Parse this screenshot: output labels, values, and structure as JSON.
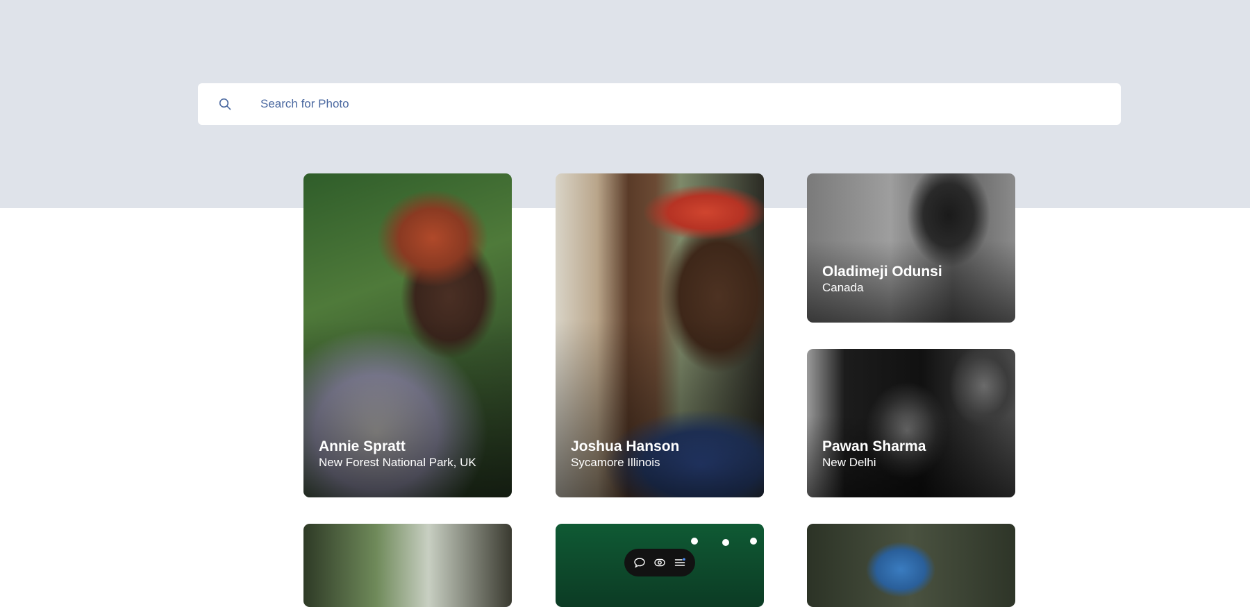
{
  "search": {
    "placeholder": "Search for Photo",
    "icon": "search-icon"
  },
  "cards": [
    {
      "name": "Annie Spratt",
      "location": "New Forest National Park, UK"
    },
    {
      "name": "Joshua Hanson",
      "location": "Sycamore Illinois"
    },
    {
      "name": "Oladimeji Odunsi",
      "location": "Canada"
    },
    {
      "name": "Pawan Sharma",
      "location": "New Delhi"
    },
    {
      "name": "",
      "location": ""
    },
    {
      "name": "",
      "location": ""
    },
    {
      "name": "",
      "location": ""
    }
  ],
  "toolbar": {
    "icons": [
      "comment-icon",
      "eye-icon",
      "list-settings-icon"
    ]
  },
  "colors": {
    "hero_background": "#dfe3ea",
    "search_text": "#4a68a0",
    "toolbar_background": "#121212"
  }
}
